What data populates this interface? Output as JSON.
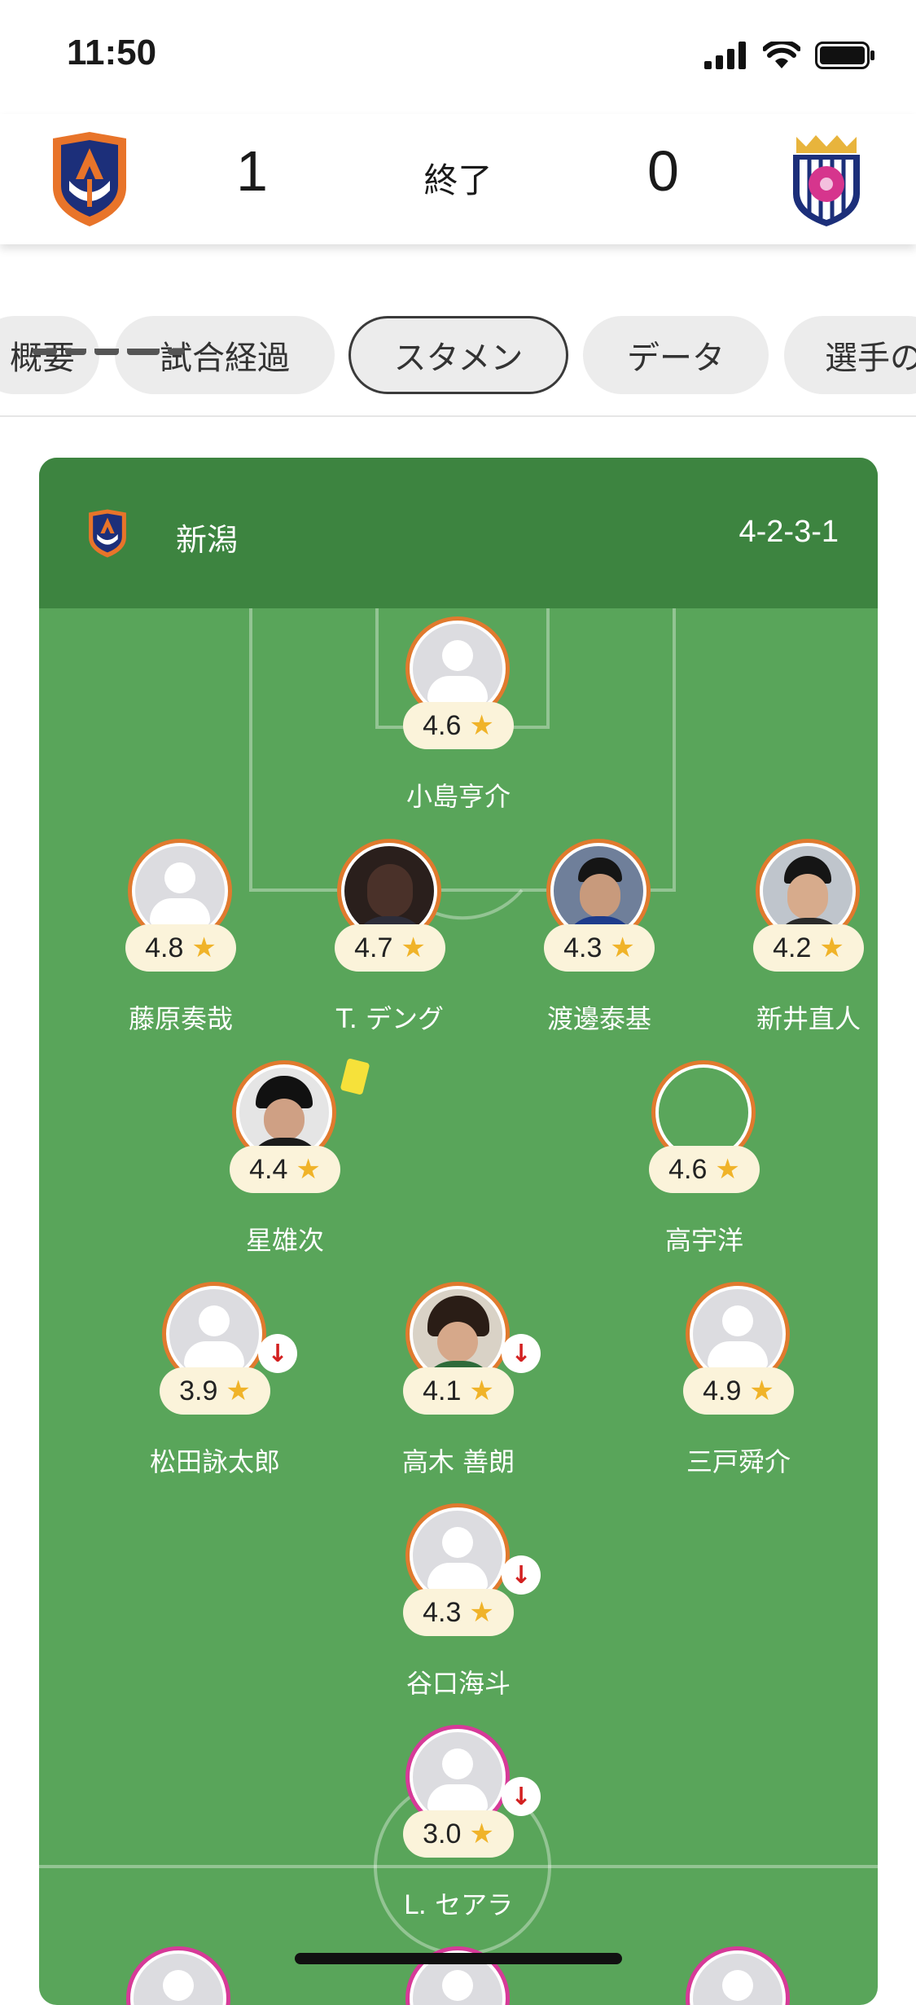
{
  "status_bar": {
    "time": "11:50"
  },
  "score_header": {
    "home_score": "1",
    "status": "終了",
    "away_score": "0"
  },
  "tabs": [
    {
      "label": "概要"
    },
    {
      "label": "試合経過"
    },
    {
      "label": "スタメン"
    },
    {
      "label": "データ"
    },
    {
      "label": "選手の"
    }
  ],
  "active_tab": "スタメン",
  "pitch": {
    "team_name": "新潟",
    "formation": "4-2-3-1",
    "players": [
      {
        "name": "小島亨介",
        "rating": "4.6"
      },
      {
        "name": "藤原奏哉",
        "rating": "4.8"
      },
      {
        "name": "T. デング",
        "rating": "4.7"
      },
      {
        "name": "渡邊泰基",
        "rating": "4.3"
      },
      {
        "name": "新井直人",
        "rating": "4.2"
      },
      {
        "name": "星雄次",
        "rating": "4.4"
      },
      {
        "name": "高宇洋",
        "rating": "4.6"
      },
      {
        "name": "松田詠太郎",
        "rating": "3.9"
      },
      {
        "name": "高木 善朗",
        "rating": "4.1"
      },
      {
        "name": "三戸舜介",
        "rating": "4.9"
      },
      {
        "name": "谷口海斗",
        "rating": "4.3"
      },
      {
        "name": "L. セアラ",
        "rating": "3.0"
      }
    ]
  },
  "colors": {
    "home_ring": "#e07a2e",
    "away_ring": "#d63a98",
    "pitch": "#59a55a",
    "pitch_header": "#3d8440",
    "star": "#f0b329"
  }
}
